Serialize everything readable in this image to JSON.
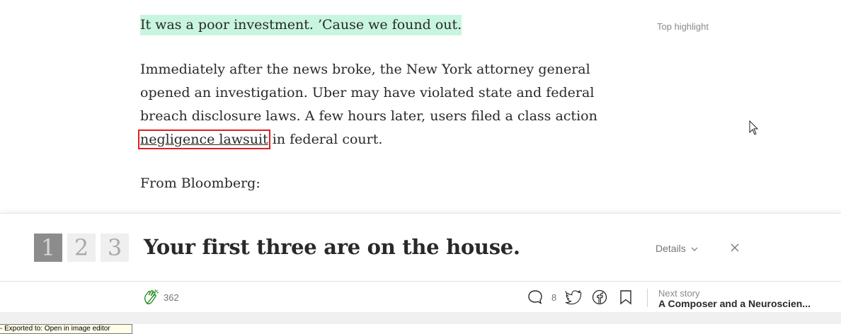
{
  "article": {
    "highlight_text": "It was a poor investment. ’Cause we found out.",
    "top_highlight_label": "Top highlight",
    "paragraph_before_link": "Immediately after the news broke, the New York attorney general opened an investigation. Uber may have violated state and federal breach disclosure laws. A few hours later, users filed a class action ",
    "paragraph_link": "negligence lawsuit",
    "paragraph_after_link": " in federal court.",
    "from_line": "From Bloomberg:"
  },
  "paywall": {
    "tiles": [
      "1",
      "2",
      "3"
    ],
    "title": "Your first three are on the house.",
    "details_label": "Details",
    "close_icon": "close-icon"
  },
  "action_bar": {
    "clap_count": "362",
    "response_count": "8",
    "next_label": "Next story",
    "next_title": "A Composer and a Neuroscien..."
  },
  "tooltip": {
    "text": "- Exported to: Open in image editor"
  },
  "colors": {
    "highlight": "#c8f5df",
    "annotation_box": "#e01f1f",
    "clap_icon": "#1a8917"
  }
}
